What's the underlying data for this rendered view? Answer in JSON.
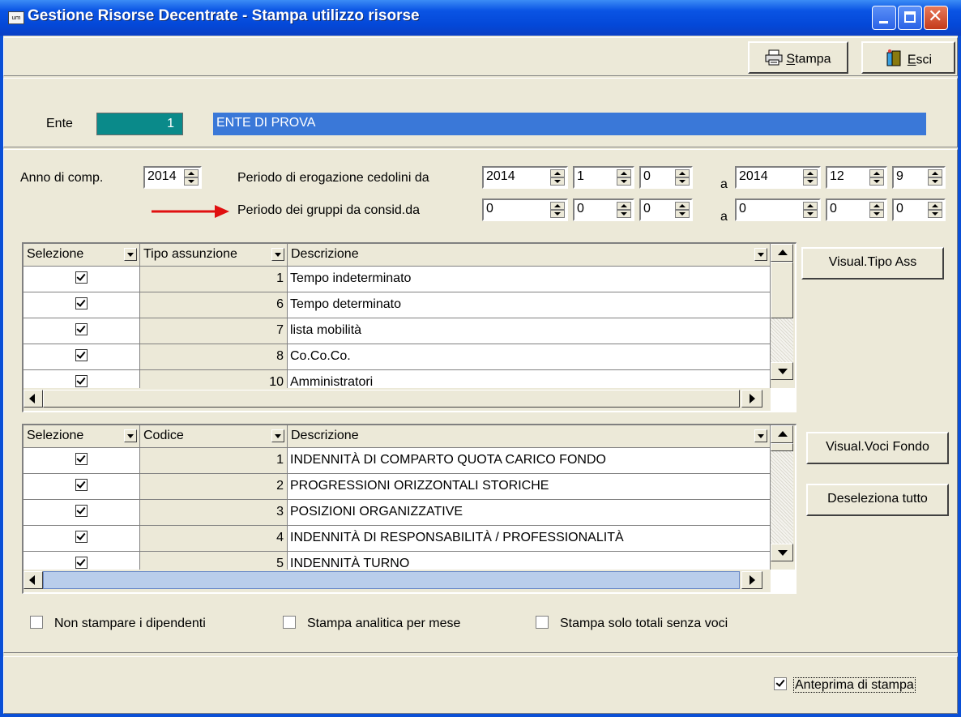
{
  "window": {
    "title": "Gestione Risorse Decentrate - Stampa utilizzo risorse",
    "icon_text": "um"
  },
  "toolbar": {
    "print_label": "Stampa",
    "print_accel": "S",
    "print_rest": "tampa",
    "exit_accel": "E",
    "exit_rest": "sci"
  },
  "ente": {
    "label": "Ente",
    "code": "1",
    "name": "ENTE DI PROVA"
  },
  "period": {
    "anno_label": "Anno di comp.",
    "anno_value": "2014",
    "erog_label": "Periodo di erogazione cedolini da",
    "erog_from": [
      "2014",
      "1",
      "0"
    ],
    "a_label": "a",
    "erog_to": [
      "2014",
      "12",
      "9"
    ],
    "gruppi_label": "Periodo dei gruppi da consid.da",
    "gruppi_from": [
      "0",
      "0",
      "0"
    ],
    "gruppi_to": [
      "0",
      "0",
      "0"
    ]
  },
  "grid_tipo": {
    "headers": [
      "Selezione",
      "Tipo assunzione",
      "Descrizione"
    ],
    "rows": [
      {
        "sel": true,
        "code": "1",
        "desc": "Tempo indeterminato"
      },
      {
        "sel": true,
        "code": "6",
        "desc": "Tempo determinato"
      },
      {
        "sel": true,
        "code": "7",
        "desc": "lista mobilità"
      },
      {
        "sel": true,
        "code": "8",
        "desc": "Co.Co.Co."
      },
      {
        "sel": true,
        "code": "10",
        "desc": "Amministratori"
      }
    ]
  },
  "grid_voci": {
    "headers": [
      "Selezione",
      "Codice",
      "Descrizione"
    ],
    "rows": [
      {
        "sel": true,
        "code": "1",
        "desc": "INDENNITÀ DI COMPARTO QUOTA CARICO FONDO"
      },
      {
        "sel": true,
        "code": "2",
        "desc": "PROGRESSIONI ORIZZONTALI STORICHE"
      },
      {
        "sel": true,
        "code": "3",
        "desc": "POSIZIONI ORGANIZZATIVE"
      },
      {
        "sel": true,
        "code": "4",
        "desc": "INDENNITÀ DI RESPONSABILITÀ / PROFESSIONALITÀ"
      },
      {
        "sel": true,
        "code": "5",
        "desc": "INDENNITÀ TURNO"
      }
    ]
  },
  "side_buttons": {
    "visual_tipo": "Visual.Tipo Ass",
    "visual_voci": "Visual.Voci Fondo",
    "deseleziona": "Deseleziona tutto"
  },
  "options": {
    "non_stampare": "Non stampare i dipendenti",
    "analitica": "Stampa analitica per mese",
    "solo_totali": "Stampa solo totali senza voci",
    "anteprima": "Anteprima di stampa",
    "non_stampare_checked": false,
    "analitica_checked": false,
    "solo_totali_checked": false,
    "anteprima_checked": true
  },
  "colors": {
    "titlebar": "#0a54e4",
    "ente_code_bg": "#0a8a8a",
    "ente_name_bg": "#3a78d8",
    "arrow": "#e01010"
  }
}
